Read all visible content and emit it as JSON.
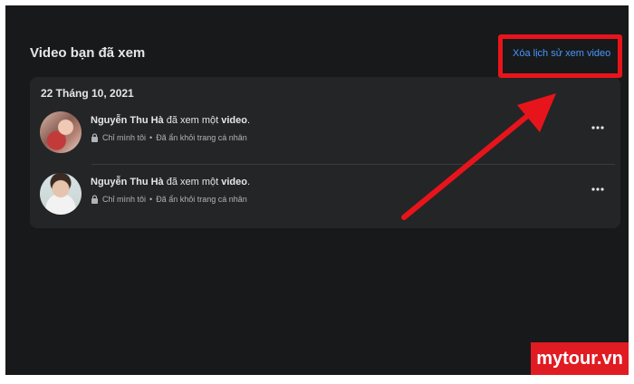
{
  "header": {
    "title": "Video bạn đã xem",
    "clear_link": "Xóa lịch sử xem video"
  },
  "history": {
    "date": "22 Tháng 10, 2021",
    "items": [
      {
        "name": "Nguyễn Thu Hà",
        "action": " đã xem một ",
        "object": "video",
        "suffix": ".",
        "privacy_icon": "lock-icon",
        "privacy": "Chỉ mình tôi",
        "separator": "•",
        "status": "Đã ẩn khỏi trang cá nhân",
        "more_icon": "more-icon"
      },
      {
        "name": "Nguyễn Thu Hà",
        "action": " đã xem một ",
        "object": "video",
        "suffix": ".",
        "privacy_icon": "lock-icon",
        "privacy": "Chỉ mình tôi",
        "separator": "•",
        "status": "Đã ẩn khỏi trang cá nhân",
        "more_icon": "more-icon"
      }
    ]
  },
  "watermark": "mytour.vn",
  "colors": {
    "background": "#18191a",
    "card": "#242526",
    "link": "#4599ff",
    "annotation": "#e8141b"
  }
}
